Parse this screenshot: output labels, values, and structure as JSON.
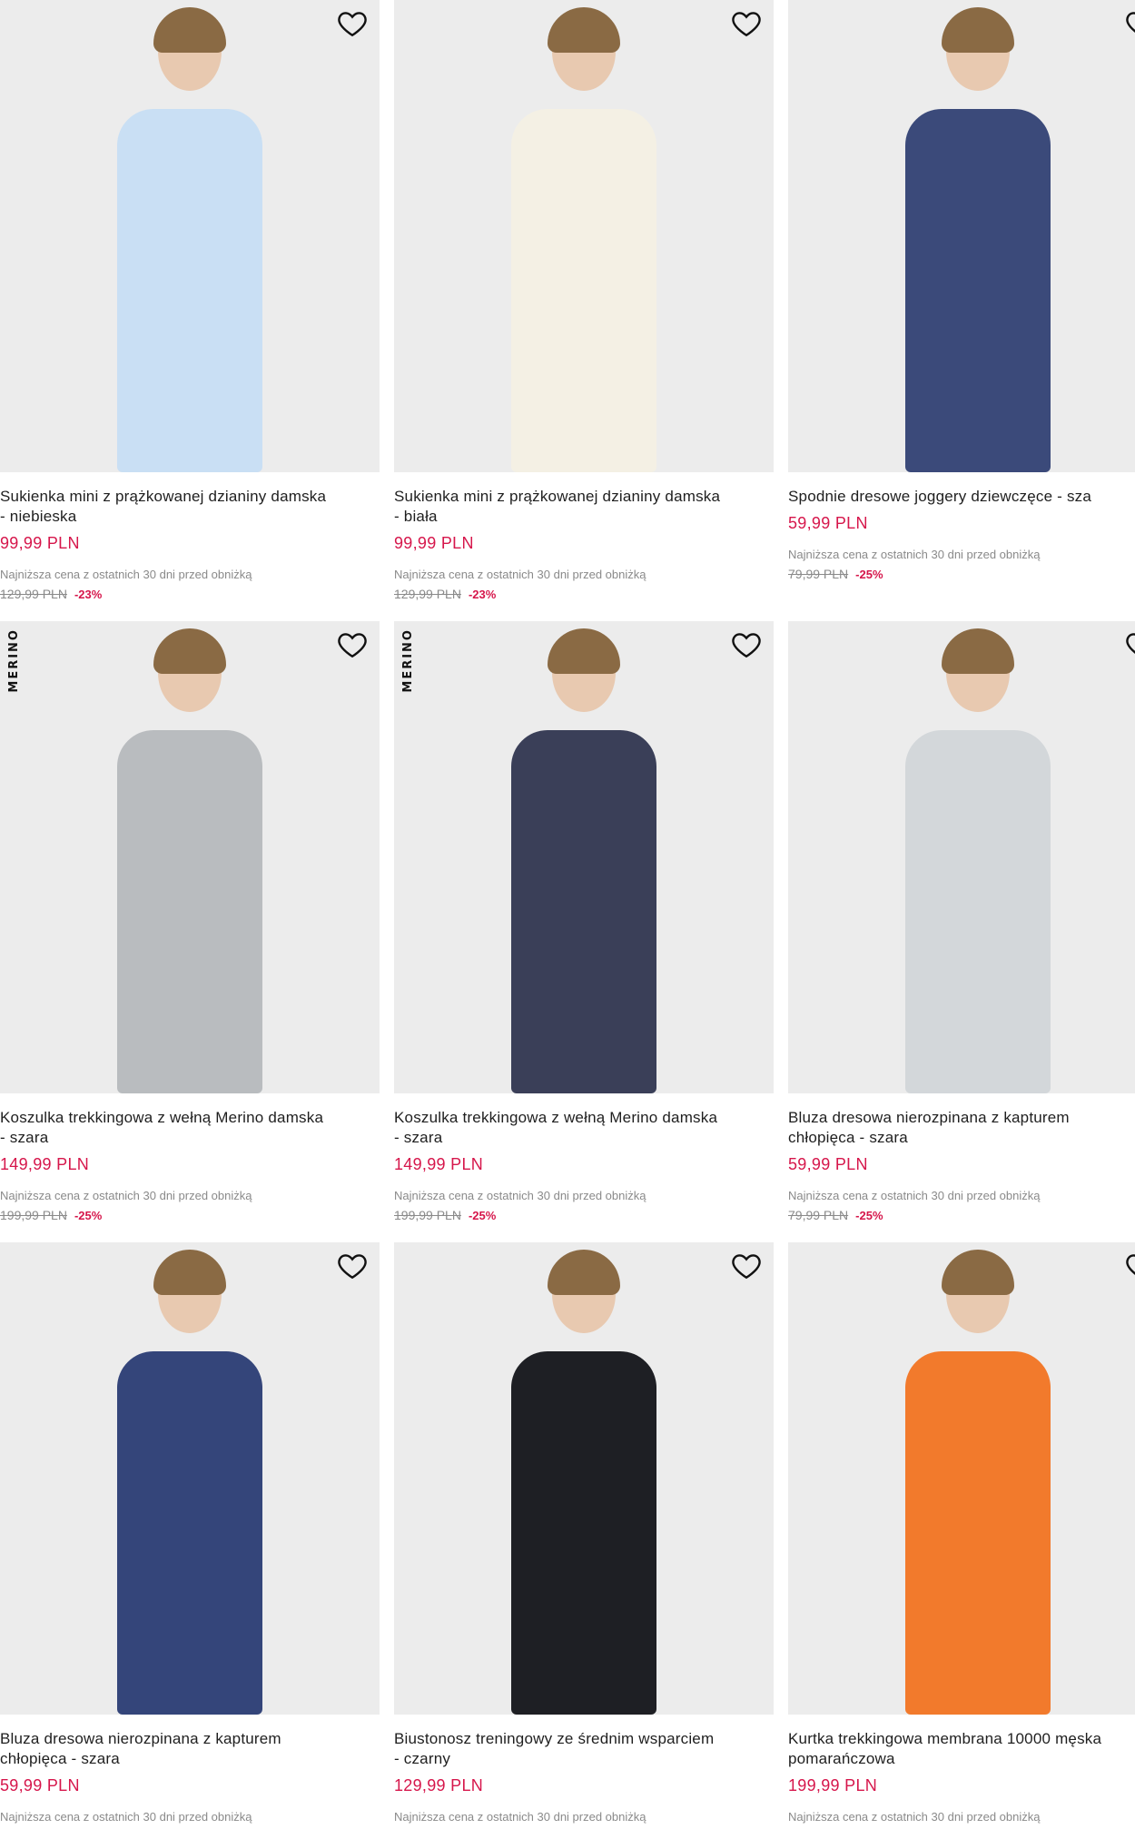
{
  "colors": {
    "accent": "#d6164b",
    "muted": "#8a8a8a",
    "image_bg": "#ececec"
  },
  "products": [
    {
      "name": "Sukienka mini z prążkowanej dzianiny damska\n- niebieska",
      "price": "99,99 PLN",
      "lowest_label": "Najniższa cena z ostatnich 30 dni przed obniżką",
      "old_price": "129,99 PLN",
      "discount": "-23%",
      "badge": "",
      "garment_color": "#c9dff4"
    },
    {
      "name": "Sukienka mini z prążkowanej dzianiny damska\n- biała",
      "price": "99,99 PLN",
      "lowest_label": "Najniższa cena z ostatnich 30 dni przed obniżką",
      "old_price": "129,99 PLN",
      "discount": "-23%",
      "badge": "",
      "garment_color": "#f4f0e4"
    },
    {
      "name": "Spodnie dresowe joggery dziewczęce - sza",
      "price": "59,99 PLN",
      "lowest_label": "Najniższa cena z ostatnich 30 dni przed obniżką",
      "old_price": "79,99 PLN",
      "discount": "-25%",
      "badge": "",
      "garment_color": "#3b4a7a"
    },
    {
      "name": "Koszulka trekkingowa z wełną Merino damska\n- szara",
      "price": "149,99 PLN",
      "lowest_label": "Najniższa cena z ostatnich 30 dni przed obniżką",
      "old_price": "199,99 PLN",
      "discount": "-25%",
      "badge": "MERINO",
      "garment_color": "#b9bcbf"
    },
    {
      "name": "Koszulka trekkingowa z wełną Merino damska\n- szara",
      "price": "149,99 PLN",
      "lowest_label": "Najniższa cena z ostatnich 30 dni przed obniżką",
      "old_price": "199,99 PLN",
      "discount": "-25%",
      "badge": "MERINO",
      "garment_color": "#3a3f58"
    },
    {
      "name": "Bluza dresowa nierozpinana z kapturem\nchłopięca - szara",
      "price": "59,99 PLN",
      "lowest_label": "Najniższa cena z ostatnich 30 dni przed obniżką",
      "old_price": "79,99 PLN",
      "discount": "-25%",
      "badge": "",
      "garment_color": "#d3d7da"
    },
    {
      "name": "Bluza dresowa nierozpinana z kapturem\nchłopięca - szara",
      "price": "59,99 PLN",
      "lowest_label": "Najniższa cena z ostatnich 30 dni przed obniżką",
      "old_price": "",
      "discount": "",
      "badge": "",
      "garment_color": "#34457a"
    },
    {
      "name": "Biustonosz treningowy ze średnim wsparciem\n- czarny",
      "price": "129,99 PLN",
      "lowest_label": "Najniższa cena z ostatnich 30 dni przed obniżką",
      "old_price": "",
      "discount": "",
      "badge": "",
      "garment_color": "#1e1f24"
    },
    {
      "name": "Kurtka trekkingowa membrana 10000 męska\npomarańczowa",
      "price": "199,99 PLN",
      "lowest_label": "Najniższa cena z ostatnich 30 dni przed obniżką",
      "old_price": "",
      "discount": "",
      "badge": "",
      "garment_color": "#f27a2c"
    }
  ],
  "icons": {
    "wishlist": "heart-outline-icon"
  }
}
